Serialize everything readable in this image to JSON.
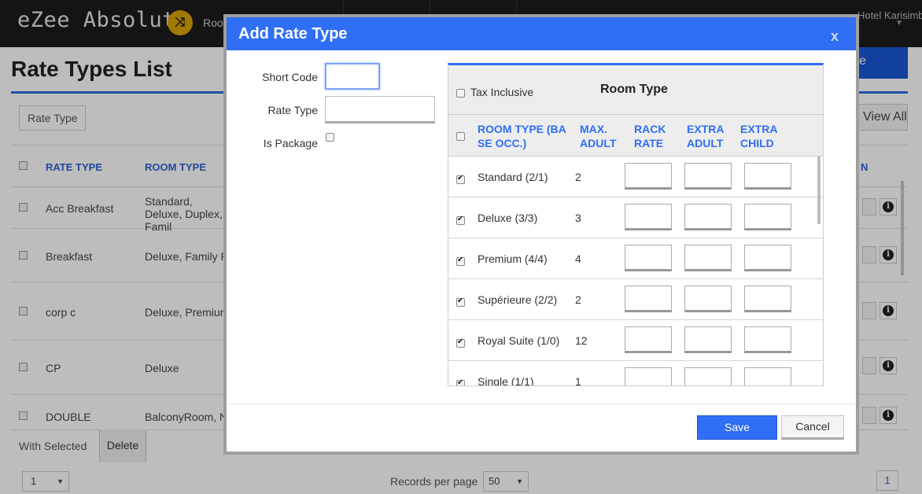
{
  "app": {
    "brand": "eZee Absolute",
    "brand_badge_icon": "shuffle-icon",
    "top_nav_item": "Rooms",
    "hotel_name": "Hotel Karisimbi"
  },
  "page": {
    "title": "Rate Types List",
    "add_button": "e",
    "filter_label": "Rate Type",
    "view_all_button": "View All",
    "columns": {
      "rate_type": "RATE TYPE",
      "room_type": "ROOM TYPE",
      "action": "N"
    },
    "rows": [
      {
        "rate_type": "Acc Breakfast",
        "room_type": "Standard, Deluxe, Duplex, Famil"
      },
      {
        "rate_type": "Breakfast",
        "room_type": "Deluxe, Family R"
      },
      {
        "rate_type": "corp c",
        "room_type": "Deluxe, Premium"
      },
      {
        "rate_type": "CP",
        "room_type": "Deluxe"
      },
      {
        "rate_type": "DOUBLE",
        "room_type": "BalconyRoom, N"
      }
    ],
    "footer": {
      "with_selected": "With Selected",
      "delete_button": "Delete",
      "page_select": "1",
      "records_per_page_label": "Records per page",
      "records_per_page": "50",
      "current_page": "1"
    }
  },
  "modal": {
    "title": "Add Rate Type",
    "close": "x",
    "fields": {
      "short_code_label": "Short Code",
      "short_code_value": "",
      "rate_type_label": "Rate Type",
      "rate_type_value": "",
      "is_package_label": "Is Package",
      "is_package_checked": false
    },
    "room_table": {
      "tax_inclusive_label": "Tax Inclusive",
      "tax_inclusive_checked": false,
      "title": "Room Type",
      "columns": {
        "room_type": "ROOM TYPE (BA SE OCC.)",
        "max_adult": "MAX. ADULT",
        "rack_rate": "RACK RATE",
        "extra_adult": "EXTRA ADULT",
        "extra_child": "EXTRA CHILD"
      },
      "rows": [
        {
          "name": "Standard (2/1)",
          "max_adult": "2",
          "checked": true
        },
        {
          "name": "Deluxe (3/3)",
          "max_adult": "3",
          "checked": true
        },
        {
          "name": "Premium (4/4)",
          "max_adult": "4",
          "checked": true
        },
        {
          "name": "Supérieure (2/2)",
          "max_adult": "2",
          "checked": true
        },
        {
          "name": "Royal Suite (1/0)",
          "max_adult": "12",
          "checked": true
        },
        {
          "name": "Single (1/1)",
          "max_adult": "1",
          "checked": true
        }
      ]
    },
    "buttons": {
      "save": "Save",
      "cancel": "Cancel"
    }
  }
}
